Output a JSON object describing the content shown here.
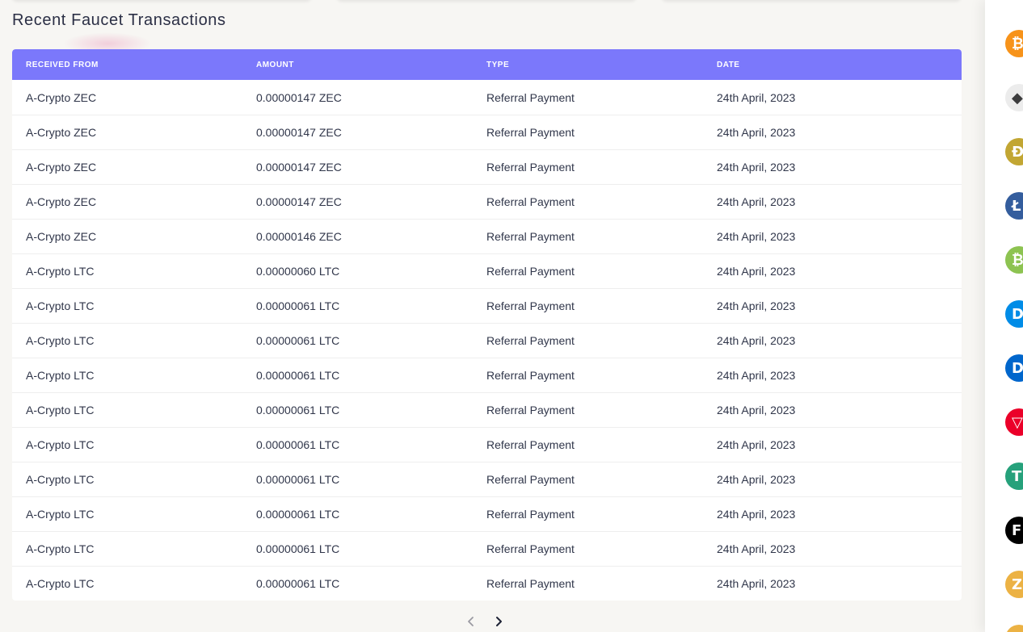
{
  "section": {
    "title": "Recent Faucet Transactions"
  },
  "table": {
    "headers": [
      "RECEIVED FROM",
      "AMOUNT",
      "TYPE",
      "DATE"
    ],
    "rows": [
      [
        "A-Crypto ZEC",
        "0.00000147 ZEC",
        "Referral Payment",
        "24th April, 2023"
      ],
      [
        "A-Crypto ZEC",
        "0.00000147 ZEC",
        "Referral Payment",
        "24th April, 2023"
      ],
      [
        "A-Crypto ZEC",
        "0.00000147 ZEC",
        "Referral Payment",
        "24th April, 2023"
      ],
      [
        "A-Crypto ZEC",
        "0.00000147 ZEC",
        "Referral Payment",
        "24th April, 2023"
      ],
      [
        "A-Crypto ZEC",
        "0.00000146 ZEC",
        "Referral Payment",
        "24th April, 2023"
      ],
      [
        "A-Crypto LTC",
        "0.00000060 LTC",
        "Referral Payment",
        "24th April, 2023"
      ],
      [
        "A-Crypto LTC",
        "0.00000061 LTC",
        "Referral Payment",
        "24th April, 2023"
      ],
      [
        "A-Crypto LTC",
        "0.00000061 LTC",
        "Referral Payment",
        "24th April, 2023"
      ],
      [
        "A-Crypto LTC",
        "0.00000061 LTC",
        "Referral Payment",
        "24th April, 2023"
      ],
      [
        "A-Crypto LTC",
        "0.00000061 LTC",
        "Referral Payment",
        "24th April, 2023"
      ],
      [
        "A-Crypto LTC",
        "0.00000061 LTC",
        "Referral Payment",
        "24th April, 2023"
      ],
      [
        "A-Crypto LTC",
        "0.00000061 LTC",
        "Referral Payment",
        "24th April, 2023"
      ],
      [
        "A-Crypto LTC",
        "0.00000061 LTC",
        "Referral Payment",
        "24th April, 2023"
      ],
      [
        "A-Crypto LTC",
        "0.00000061 LTC",
        "Referral Payment",
        "24th April, 2023"
      ],
      [
        "A-Crypto LTC",
        "0.00000061 LTC",
        "Referral Payment",
        "24th April, 2023"
      ]
    ]
  },
  "pagination": {
    "prev_icon": "chevron-left-icon",
    "next_icon": "chevron-right-icon"
  },
  "colors": {
    "header_bg": "#7b78fb",
    "page_bg": "#f7f6f3",
    "text": "#30364a"
  },
  "coin_sidebar": {
    "coins": [
      {
        "name": "bitcoin-icon",
        "glyph": "₿",
        "color": "#f7931a"
      },
      {
        "name": "ethereum-icon",
        "glyph": "◆",
        "color": "#ececec"
      },
      {
        "name": "dogecoin-icon",
        "glyph": "Ð",
        "color": "#c2a633"
      },
      {
        "name": "litecoin-icon",
        "glyph": "Ł",
        "color": "#345d9d"
      },
      {
        "name": "bitcoin-cash-icon",
        "glyph": "₿",
        "color": "#8dc351"
      },
      {
        "name": "dash-icon",
        "glyph": "D",
        "color": "#008ce7"
      },
      {
        "name": "digibyte-icon",
        "glyph": "D",
        "color": "#0066cc"
      },
      {
        "name": "tron-icon",
        "glyph": "▽",
        "color": "#eb0029"
      },
      {
        "name": "tether-icon",
        "glyph": "T",
        "color": "#26a17b"
      },
      {
        "name": "feyorra-icon",
        "glyph": "F",
        "color": "#000000"
      },
      {
        "name": "zcash-icon",
        "glyph": "Z",
        "color": "#ecb244"
      },
      {
        "name": "coin-icon",
        "glyph": "",
        "color": "#ecb244"
      }
    ]
  }
}
